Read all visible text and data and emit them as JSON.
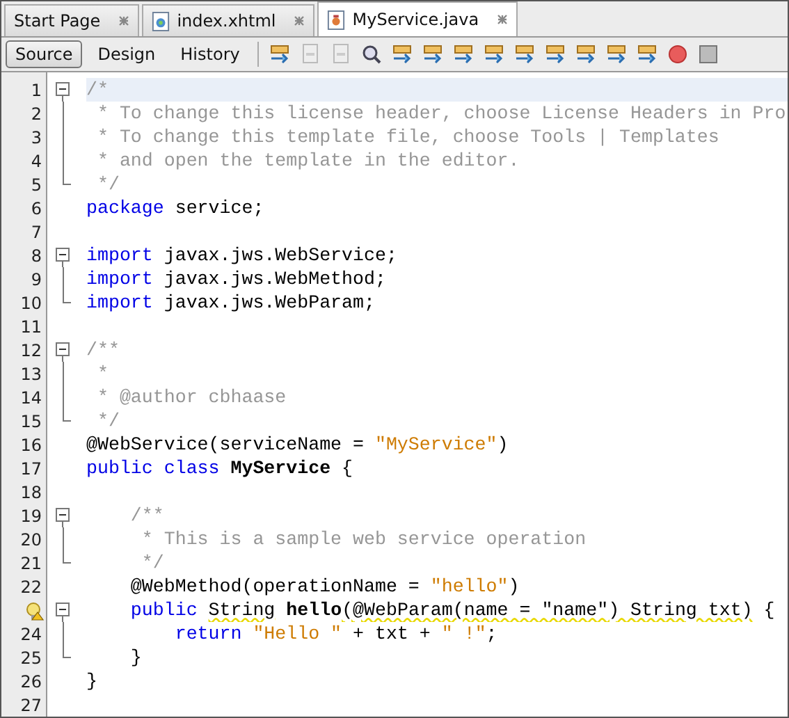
{
  "tabs": [
    {
      "label": "Start Page",
      "selected": false
    },
    {
      "label": "index.xhtml",
      "selected": false
    },
    {
      "label": "MyService.java",
      "selected": true
    }
  ],
  "views": [
    {
      "label": "Source",
      "selected": true
    },
    {
      "label": "Design",
      "selected": false
    },
    {
      "label": "History",
      "selected": false
    }
  ],
  "lines": [
    {
      "number": "1",
      "fold_start": true,
      "fold_end": false,
      "current": true,
      "tokens": [
        {
          "kind": "comment",
          "text": "/*"
        }
      ]
    },
    {
      "number": "2",
      "fold_start": false,
      "fold_end": false,
      "current": false,
      "tokens": [
        {
          "kind": "comment",
          "text": " * To change this license header, choose License Headers in Pro"
        }
      ]
    },
    {
      "number": "3",
      "fold_start": false,
      "fold_end": false,
      "current": false,
      "tokens": [
        {
          "kind": "comment",
          "text": " * To change this template file, choose Tools | Templates"
        }
      ]
    },
    {
      "number": "4",
      "fold_start": false,
      "fold_end": false,
      "current": false,
      "tokens": [
        {
          "kind": "comment",
          "text": " * and open the template in the editor."
        }
      ]
    },
    {
      "number": "5",
      "fold_start": false,
      "fold_end": true,
      "current": false,
      "tokens": [
        {
          "kind": "comment",
          "text": " */"
        }
      ]
    },
    {
      "number": "6",
      "fold_start": false,
      "fold_end": false,
      "current": false,
      "tokens": [
        {
          "kind": "keyword",
          "text": "package"
        },
        {
          "kind": "plain",
          "text": " service;"
        }
      ]
    },
    {
      "number": "7",
      "fold_start": false,
      "fold_end": false,
      "current": false
    },
    {
      "number": "8",
      "fold_start": true,
      "fold_end": false,
      "current": false,
      "tokens": [
        {
          "kind": "keyword",
          "text": "import"
        },
        {
          "kind": "plain",
          "text": " javax.jws.WebService;"
        }
      ]
    },
    {
      "number": "9",
      "fold_start": false,
      "fold_end": false,
      "current": false,
      "tokens": [
        {
          "kind": "keyword",
          "text": "import"
        },
        {
          "kind": "plain",
          "text": " javax.jws.WebMethod;"
        }
      ]
    },
    {
      "number": "10",
      "fold_start": false,
      "fold_end": true,
      "current": false,
      "tokens": [
        {
          "kind": "keyword",
          "text": "import"
        },
        {
          "kind": "plain",
          "text": " javax.jws.WebParam;"
        }
      ]
    },
    {
      "number": "11",
      "fold_start": false,
      "fold_end": false,
      "current": false
    },
    {
      "number": "12",
      "fold_start": true,
      "fold_end": false,
      "current": false,
      "tokens": [
        {
          "kind": "comment",
          "text": "/**"
        }
      ]
    },
    {
      "number": "13",
      "fold_start": false,
      "fold_end": false,
      "current": false,
      "tokens": [
        {
          "kind": "comment",
          "text": " *"
        }
      ]
    },
    {
      "number": "14",
      "fold_start": false,
      "fold_end": false,
      "current": false,
      "tokens": [
        {
          "kind": "comment",
          "text": " * @author cbhaase"
        }
      ]
    },
    {
      "number": "15",
      "fold_start": false,
      "fold_end": true,
      "current": false,
      "tokens": [
        {
          "kind": "comment",
          "text": " */"
        }
      ]
    },
    {
      "number": "16",
      "fold_start": false,
      "fold_end": false,
      "current": false,
      "tokens": [
        {
          "kind": "plain",
          "text": "@WebService(serviceName = "
        },
        {
          "kind": "string",
          "text": "\"MyService\""
        },
        {
          "kind": "plain",
          "text": ")"
        }
      ]
    },
    {
      "number": "17",
      "fold_start": false,
      "fold_end": false,
      "current": false,
      "tokens": [
        {
          "kind": "keyword",
          "text": "public class "
        },
        {
          "kind": "name",
          "text": "MyService"
        },
        {
          "kind": "plain",
          "text": " {"
        }
      ]
    },
    {
      "number": "18",
      "fold_start": false,
      "fold_end": false,
      "current": false
    },
    {
      "number": "19",
      "fold_start": true,
      "fold_end": false,
      "current": false,
      "tokens": [
        {
          "kind": "comment",
          "text": "    /**"
        }
      ]
    },
    {
      "number": "20",
      "fold_start": false,
      "fold_end": false,
      "current": false,
      "tokens": [
        {
          "kind": "comment",
          "text": "     * This is a sample web service operation"
        }
      ]
    },
    {
      "number": "21",
      "fold_start": false,
      "fold_end": true,
      "current": false,
      "tokens": [
        {
          "kind": "comment",
          "text": "     */"
        }
      ]
    },
    {
      "number": "22",
      "fold_start": false,
      "fold_end": false,
      "current": false,
      "tokens": [
        {
          "kind": "plain",
          "text": "    @WebMethod(operationName = "
        },
        {
          "kind": "string",
          "text": "\"hello\""
        },
        {
          "kind": "plain",
          "text": ")"
        }
      ]
    },
    {
      "fold_start": true,
      "fold_end": false,
      "current": false,
      "hint": true,
      "tokens": [
        {
          "kind": "keyword",
          "text": "    public "
        },
        {
          "kind": "warning",
          "text": "String"
        },
        {
          "kind": "name",
          "text": " hello"
        },
        {
          "kind": "warning",
          "text": "(@WebParam(name = \"name\") String txt)"
        },
        {
          "kind": "plain",
          "text": " {"
        }
      ]
    },
    {
      "number": "24",
      "fold_start": false,
      "fold_end": false,
      "current": false,
      "tokens": [
        {
          "kind": "keyword",
          "text": "        return "
        },
        {
          "kind": "string",
          "text": "\"Hello \""
        },
        {
          "kind": "plain",
          "text": " + txt + "
        },
        {
          "kind": "string",
          "text": "\" !\""
        },
        {
          "kind": "plain",
          "text": ";"
        }
      ]
    },
    {
      "number": "25",
      "fold_start": false,
      "fold_end": true,
      "current": false,
      "tokens": [
        {
          "kind": "plain",
          "text": "    }"
        }
      ]
    },
    {
      "number": "26",
      "fold_start": false,
      "fold_end": false,
      "current": false,
      "tokens": [
        {
          "kind": "plain",
          "text": "}"
        }
      ]
    },
    {
      "number": "27",
      "fold_start": false,
      "fold_end": false,
      "current": false
    }
  ]
}
